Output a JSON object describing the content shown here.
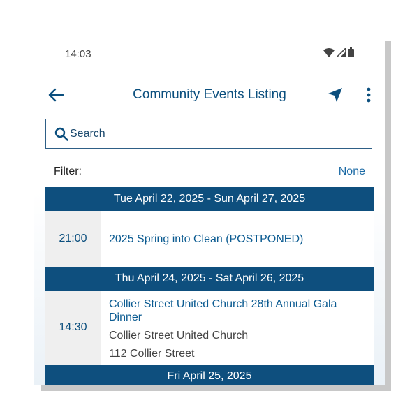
{
  "status_bar": {
    "time": "14:03",
    "icons": [
      "wifi-icon",
      "cell-signal-icon",
      "battery-icon"
    ]
  },
  "app_bar": {
    "title": "Community Events Listing",
    "back_icon": "arrow-back-icon",
    "navigation_icon": "navigation-arrow-icon",
    "more_icon": "more-vertical-icon"
  },
  "search": {
    "placeholder": "Search",
    "value": ""
  },
  "filter": {
    "label": "Filter:",
    "value": "None"
  },
  "groups": [
    {
      "date_range": "Tue April 22, 2025 - Sun April 27, 2025",
      "events": [
        {
          "time": "21:00",
          "title": "2025 Spring into Clean (POSTPONED)"
        }
      ]
    },
    {
      "date_range": "Thu April 24, 2025 - Sat April 26, 2025",
      "events": [
        {
          "time": "14:30",
          "title": "Collier Street United Church 28th Annual Gala Dinner",
          "venue": "Collier Street United Church",
          "address": "112 Collier Street"
        }
      ]
    },
    {
      "date_range": "Fri April 25, 2025",
      "events": []
    }
  ],
  "colors": {
    "primary": "#0e4f7e",
    "link": "#1b6aa5",
    "time_cell_bg": "#efefef"
  }
}
